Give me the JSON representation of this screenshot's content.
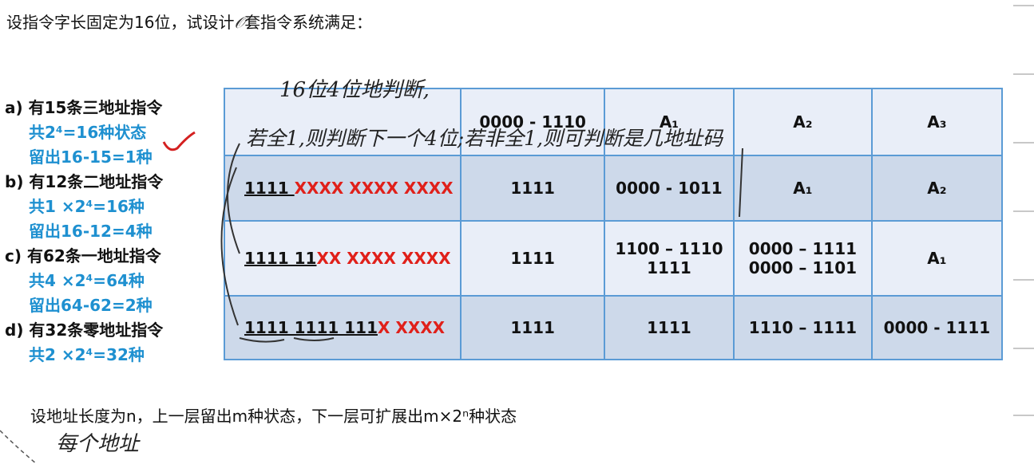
{
  "title": {
    "before": "设指令字长固定为16位，试设计",
    "pen_mark": "𝒪",
    "after": "套指令系统满足："
  },
  "items": [
    {
      "head": "a) 有15条三地址指令",
      "lines": [
        "共2⁴=16种状态",
        "留出16-15=1种"
      ]
    },
    {
      "head": "b) 有12条二地址指令",
      "lines": [
        "共1 ×2⁴=16种",
        "留出16-12=4种"
      ]
    },
    {
      "head": "c) 有62条一地址指令",
      "lines": [
        "共4 ×2⁴=64种",
        "留出64-62=2种"
      ]
    },
    {
      "head": "d) 有32条零地址指令",
      "lines": [
        "共2 ×2⁴=32种"
      ]
    }
  ],
  "table": {
    "rows": [
      {
        "c0_black": "",
        "c0_red": "",
        "c1": "0000 - 1110",
        "c2": "A₁",
        "c3": "A₂",
        "c4": "A₃"
      },
      {
        "c0_black": "1111 ",
        "c0_red": "XXXX XXXX XXXX",
        "c1": "1111",
        "c2": "0000 - 1011",
        "c3": "A₁",
        "c4": "A₂"
      },
      {
        "c0_black": "1111 11",
        "c0_red": "XX XXXX XXXX",
        "c1": "1111",
        "c2": "1100 – 1110\n1111",
        "c3": "0000 – 1111\n0000 – 1101",
        "c4": "A₁"
      },
      {
        "c0_black": "1111 1111 111",
        "c0_red": "X XXXX",
        "c1": "1111",
        "c2": "1111",
        "c3": "1110 – 1111",
        "c4": "0000 - 1111"
      }
    ]
  },
  "bottom_text": "设地址长度为n，上一层留出m种状态，下一层可扩展出m×2ⁿ种状态",
  "handwriting": {
    "line1": "16位4位地判断,",
    "line2": "若全1,则判断下一个4位;若非全1,则可判断是几地址码",
    "line3": "每个地址"
  },
  "colors": {
    "accent_blue": "#1e90d0",
    "red": "#e0201a",
    "table_border": "#5b9bd5",
    "row_dark": "#cdd9ea",
    "row_light": "#e9eef8"
  }
}
